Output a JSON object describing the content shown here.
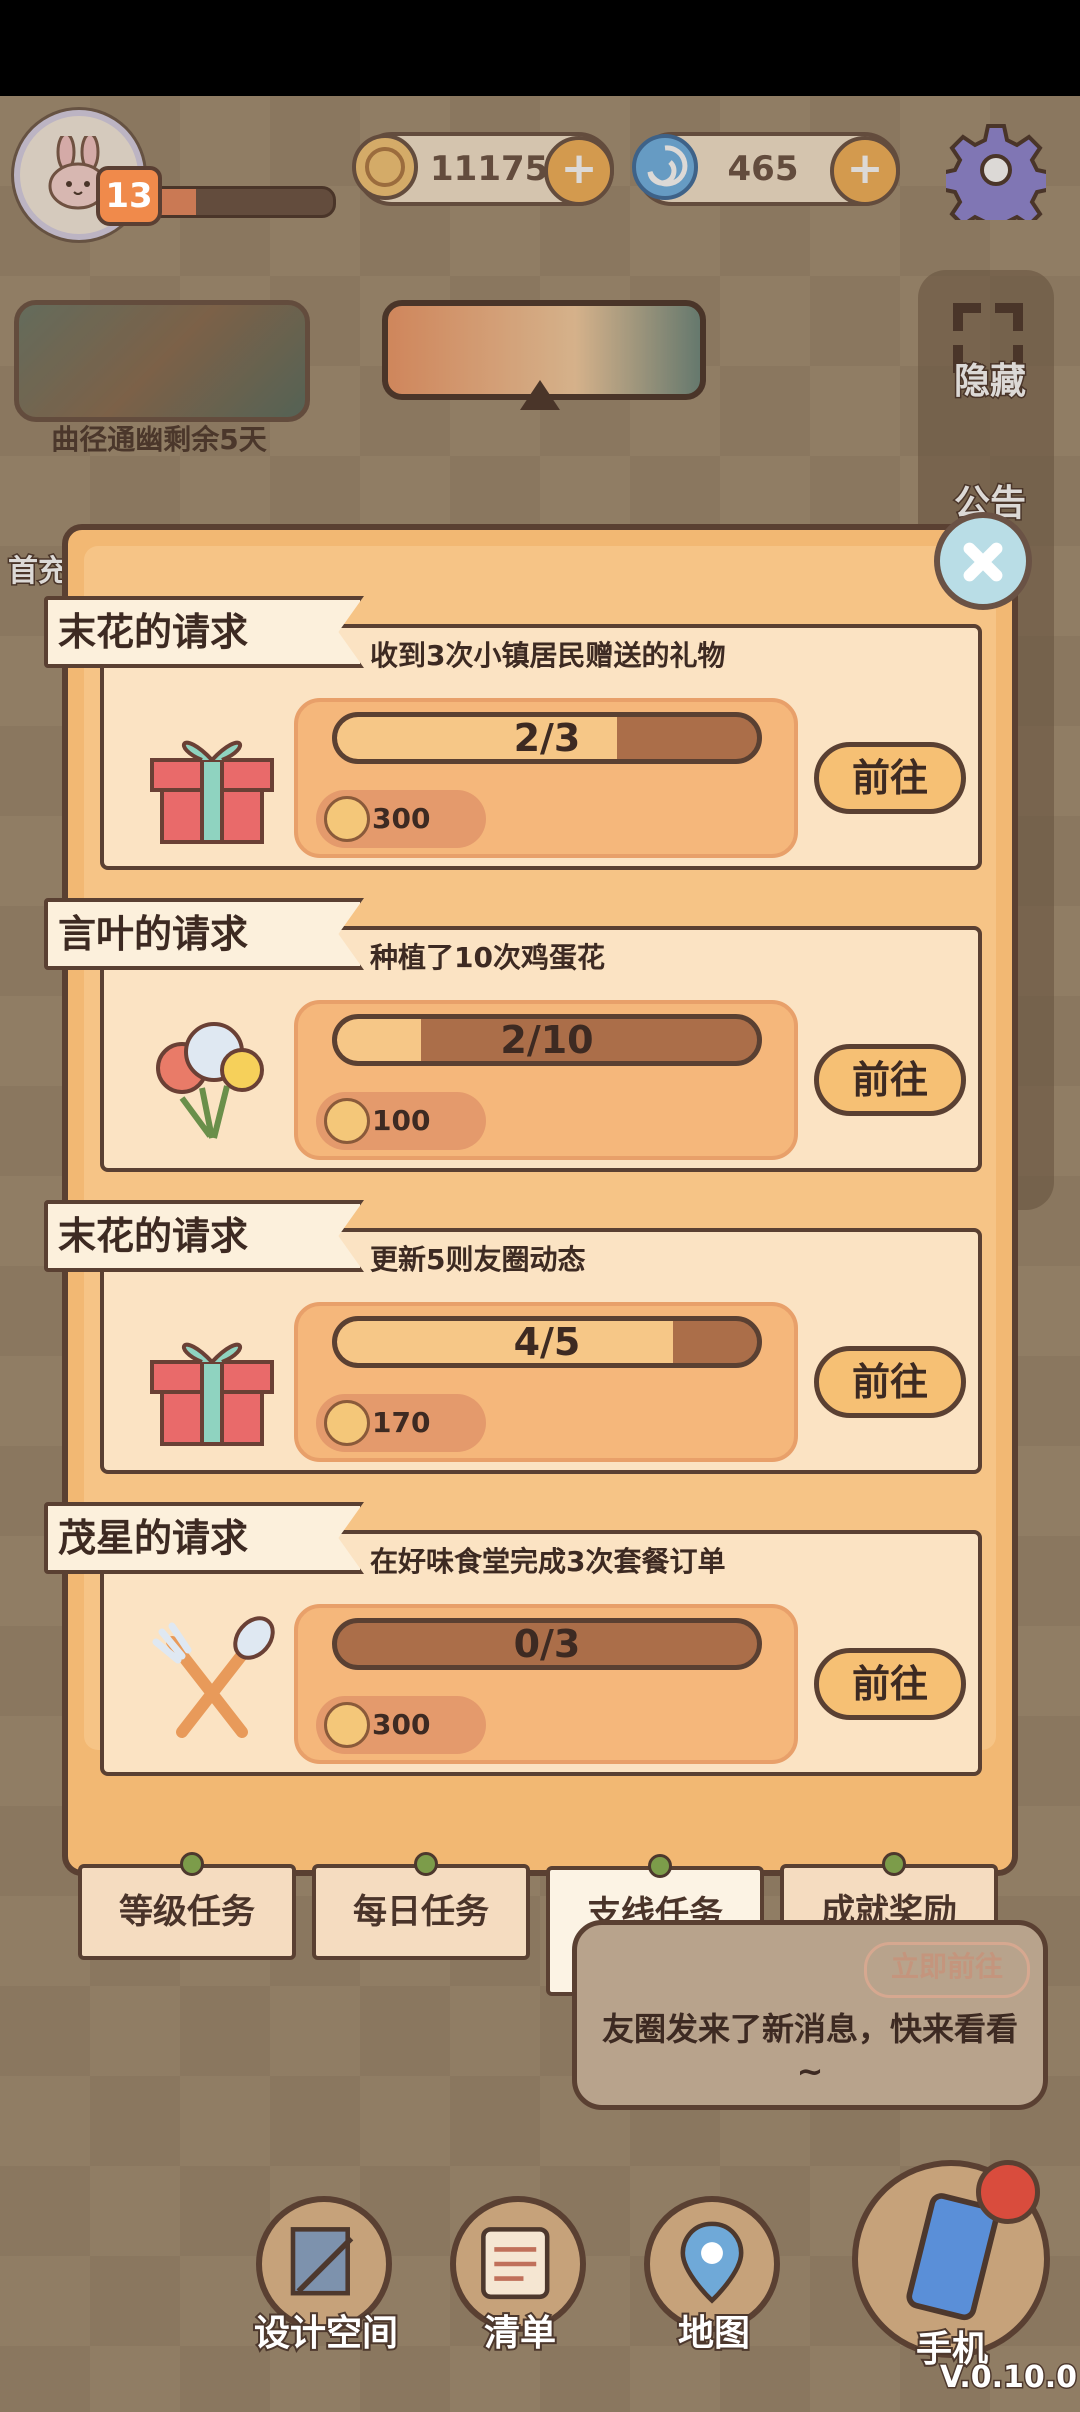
{
  "hud": {
    "level": "13",
    "xp_progress": 0.3,
    "coins": "11175",
    "gems": "465"
  },
  "event": {
    "label": "曲径通幽剩余5天"
  },
  "side": {
    "hide_label": "隐藏",
    "notice_label": "公告",
    "first_charge_label": "首充"
  },
  "quests": [
    {
      "giver": "末花的请求",
      "description": "收到3次小镇居民赠送的礼物",
      "progress_text": "2/3",
      "progress": 0.667,
      "reward": "300",
      "icon": "gift-icon",
      "button": "前往"
    },
    {
      "giver": "言叶的请求",
      "description": "种植了10次鸡蛋花",
      "progress_text": "2/10",
      "progress": 0.2,
      "reward": "100",
      "icon": "flower-bouquet-icon",
      "button": "前往"
    },
    {
      "giver": "末花的请求",
      "description": "更新5则友圈动态",
      "progress_text": "4/5",
      "progress": 0.8,
      "reward": "170",
      "icon": "gift-icon",
      "button": "前往"
    },
    {
      "giver": "茂星的请求",
      "description": "在好味食堂完成3次套餐订单",
      "progress_text": "0/3",
      "progress": 0.0,
      "reward": "300",
      "icon": "fork-spoon-icon",
      "button": "前往"
    }
  ],
  "tabs": [
    {
      "label": "等级任务",
      "active": false
    },
    {
      "label": "每日任务",
      "active": false
    },
    {
      "label": "支线任务",
      "active": true
    },
    {
      "label": "成就奖励",
      "active": false
    }
  ],
  "toast": {
    "action": "立即前往",
    "message": "友圈发来了新消息，快来看看~"
  },
  "bottom_nav": [
    {
      "label": "设计空间",
      "icon": "design-icon"
    },
    {
      "label": "清单",
      "icon": "list-icon"
    },
    {
      "label": "地图",
      "icon": "map-pin-icon"
    },
    {
      "label": "手机",
      "icon": "phone-icon"
    }
  ],
  "version": "V.0.10.0",
  "colors": {
    "panel": "#f2b873",
    "card": "#fbe3c3",
    "outline": "#5a4032",
    "progress_fill": "#f6c787",
    "progress_track": "#ab6e49"
  }
}
